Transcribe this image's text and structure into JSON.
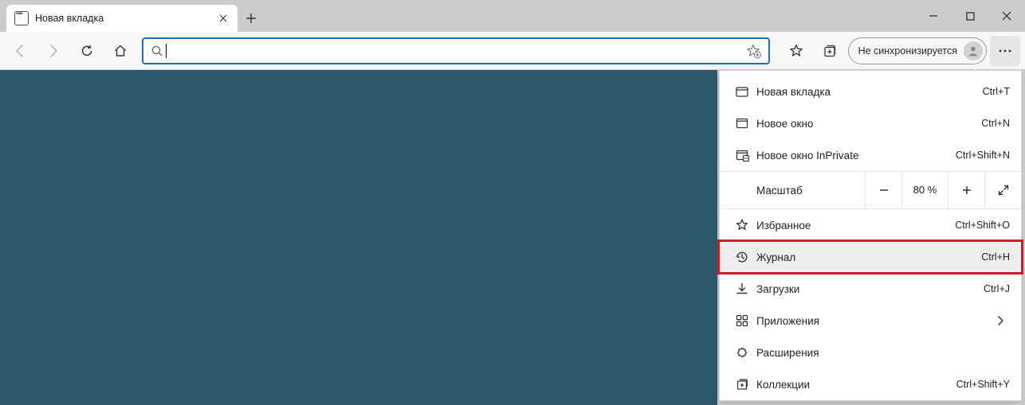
{
  "tab": {
    "title": "Новая вкладка"
  },
  "addressbar": {
    "value": ""
  },
  "sync": {
    "label": "Не синхронизируется"
  },
  "zoom": {
    "label": "Масштаб",
    "value": "80 %"
  },
  "menu": {
    "new_tab": {
      "label": "Новая вкладка",
      "shortcut": "Ctrl+T"
    },
    "new_window": {
      "label": "Новое окно",
      "shortcut": "Ctrl+N"
    },
    "inprivate": {
      "label": "Новое окно InPrivate",
      "shortcut": "Ctrl+Shift+N"
    },
    "favorites": {
      "label": "Избранное",
      "shortcut": "Ctrl+Shift+O"
    },
    "history": {
      "label": "Журнал",
      "shortcut": "Ctrl+H"
    },
    "downloads": {
      "label": "Загрузки",
      "shortcut": "Ctrl+J"
    },
    "apps": {
      "label": "Приложения"
    },
    "extensions": {
      "label": "Расширения"
    },
    "collections": {
      "label": "Коллекции",
      "shortcut": "Ctrl+Shift+Y"
    }
  }
}
